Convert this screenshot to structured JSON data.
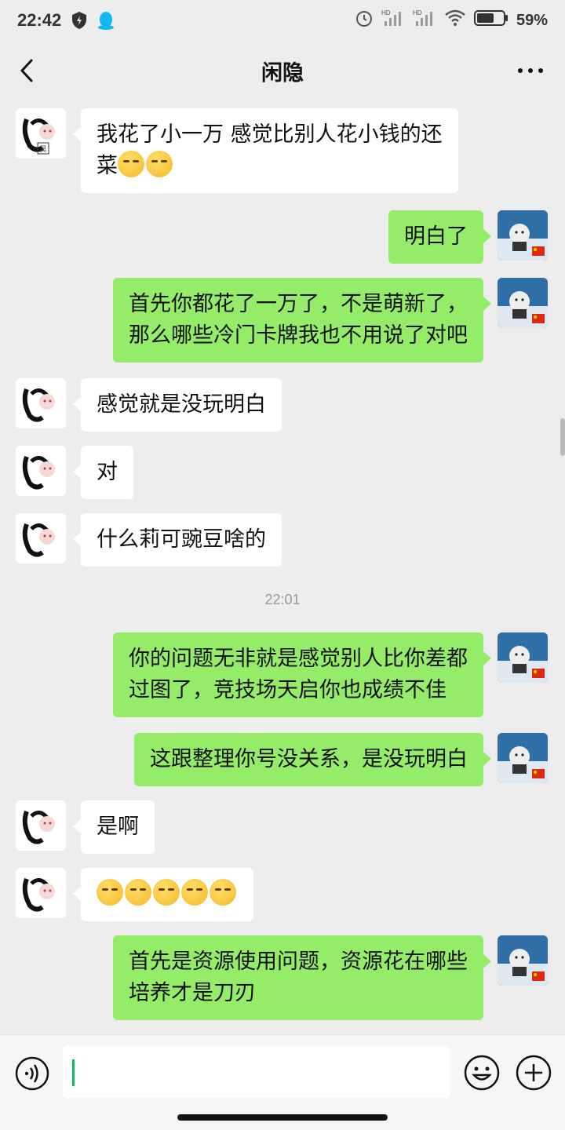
{
  "status_bar": {
    "time": "22:42",
    "battery": "59%",
    "icons": [
      "shield-icon",
      "qq-penguin-icon",
      "alarm-icon",
      "hd-signal-icon",
      "hd-signal-icon",
      "wifi-icon",
      "battery-icon"
    ]
  },
  "header": {
    "title": "闲隐",
    "back_icon": "chevron-left-icon",
    "more_icon": "more-dots-icon"
  },
  "messages": [
    {
      "side": "in",
      "lines": [
        "我花了小一万 感觉比别人花小钱的还",
        "菜"
      ],
      "emoji_count": 2
    },
    {
      "side": "out",
      "lines": [
        "明白了"
      ]
    },
    {
      "side": "out",
      "lines": [
        "首先你都花了一万了，不是萌新了，",
        "那么哪些冷门卡牌我也不用说了对吧"
      ]
    },
    {
      "side": "in",
      "lines": [
        "感觉就是没玩明白"
      ]
    },
    {
      "side": "in",
      "lines": [
        "对"
      ]
    },
    {
      "side": "in",
      "lines": [
        "什么莉可豌豆啥的"
      ]
    },
    {
      "side": "out",
      "lines": [
        "你的问题无非就是感觉别人比你差都",
        "过图了，竞技场天启你也成绩不佳"
      ]
    },
    {
      "side": "out",
      "lines": [
        "这跟整理你号没关系，是没玩明白"
      ]
    },
    {
      "side": "in",
      "lines": [
        "是啊"
      ]
    },
    {
      "side": "in",
      "lines": [
        ""
      ],
      "emoji_count": 5
    },
    {
      "side": "out",
      "lines": [
        "首先是资源使用问题，资源花在哪些",
        "培养才是刀刃"
      ]
    }
  ],
  "timestamp": "22:01",
  "avatars": {
    "left_seal_char": "吴",
    "right_flag": "china-flag-icon"
  },
  "input": {
    "voice_icon": "voice-icon",
    "emoji_icon": "emoji-smile-icon",
    "plus_icon": "plus-circle-icon",
    "value": ""
  },
  "colors": {
    "background": "#ededed",
    "incoming_bubble": "#ffffff",
    "outgoing_bubble": "#95ec69",
    "caret": "#07c160"
  }
}
